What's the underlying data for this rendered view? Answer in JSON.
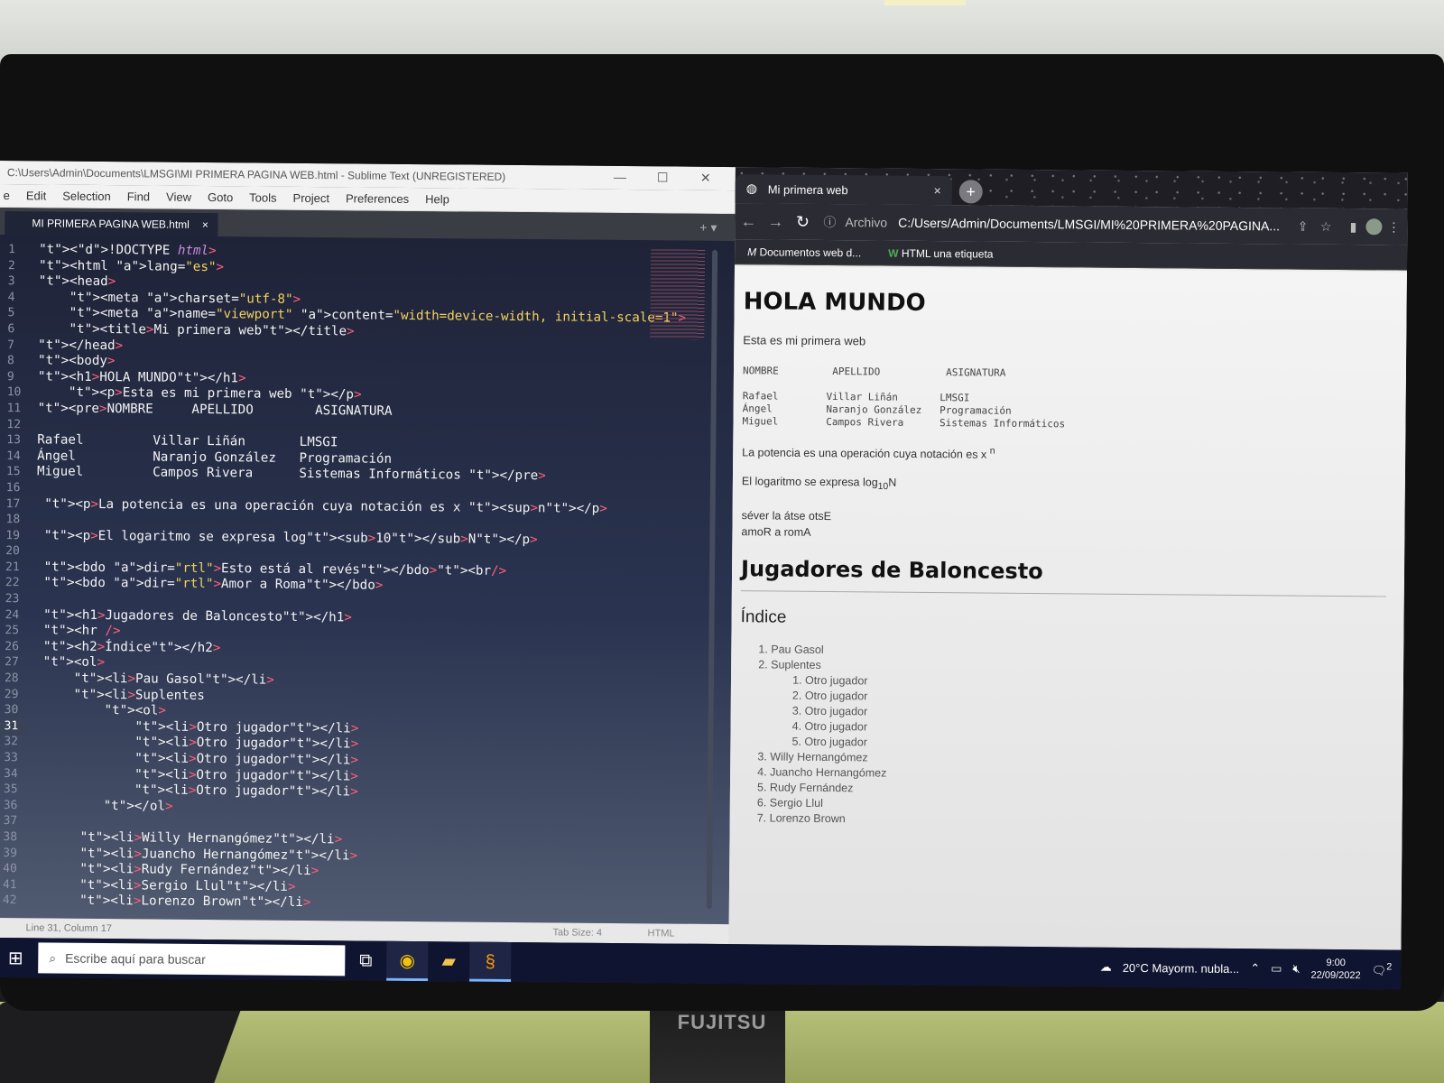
{
  "monitor_brand": "FUJITSU",
  "sublime": {
    "title": "C:\\Users\\Admin\\Documents\\LMSGI\\MI PRIMERA PAGINA WEB.html - Sublime Text (UNREGISTERED)",
    "menu": [
      "e",
      "Edit",
      "Selection",
      "Find",
      "View",
      "Goto",
      "Tools",
      "Project",
      "Preferences",
      "Help"
    ],
    "tab_label": "MI PRIMERA PAGINA WEB.html",
    "tab_close": "×",
    "active_line": 31,
    "status_position": "Line 31, Column 17",
    "status_tab_size": "Tab Size: 4",
    "status_syntax": "HTML"
  },
  "code_lines": [
    "<!DOCTYPE html>",
    "<html lang=\"es\">",
    "<head>",
    "    <meta charset=\"utf-8\">",
    "    <meta name=\"viewport\" content=\"width=device-width, initial-scale=1\">",
    "    <title>Mi primera web</title>",
    "</head>",
    "<body>",
    "<h1>HOLA MUNDO</h1>",
    "    <p>Esta es mi primera web </p>",
    "<pre>NOMBRE     APELLIDO        ASIGNATURA",
    "",
    "Rafael         Villar Liñán       LMSGI",
    "Ángel          Naranjo González   Programación",
    "Miguel         Campos Rivera      Sistemas Informáticos </pre>",
    "",
    " <p>La potencia es una operación cuya notación es x <sup>n</p>",
    "",
    " <p>El logaritmo se expresa log<sub>10</sub>N</p>",
    "",
    " <bdo dir=\"rtl\">Esto está al revés</bdo><br/>",
    " <bdo dir=\"rtl\">Amor a Roma</bdo>",
    "",
    " <h1>Jugadores de Baloncesto</h1>",
    " <hr />",
    " <h2>Índice</h2>",
    " <ol>",
    "     <li>Pau Gasol</li>",
    "     <li>Suplentes",
    "         <ol>",
    "             <li>Otro jugador</li>",
    "             <li>Otro jugador</li>",
    "             <li>Otro jugador</li>",
    "             <li>Otro jugador</li>",
    "             <li>Otro jugador</li>",
    "         </ol>",
    "",
    "      <li>Willy Hernangómez</li>",
    "      <li>Juancho Hernangómez</li>",
    "      <li>Rudy Fernández</li>",
    "      <li>Sergio Llul</li>",
    "      <li>Lorenzo Brown</li>"
  ],
  "browser": {
    "tab_title": "Mi primera web",
    "tab_close": "×",
    "new_tab": "+",
    "archivo": "Archivo",
    "url": "C:/Users/Admin/Documents/LMSGI/MI%20PRIMERA%20PAGINA...",
    "bookmarks": [
      "Documentos web d...",
      "HTML una etiqueta"
    ]
  },
  "page": {
    "h1": "HOLA MUNDO",
    "p1": "Esta es mi primera web",
    "pre_header": "NOMBRE         APELLIDO           ASIGNATURA",
    "pre_rows": "Rafael        Villar Liñán       LMSGI\nÁngel         Naranjo González   Programación\nMiguel        Campos Rivera      Sistemas Informáticos",
    "power_text": "La potencia es una operación cuya notación es x",
    "power_sup": "n",
    "log_text": "El logaritmo se expresa log",
    "log_sub": "10",
    "log_tail": "N",
    "bdo1": "séver la átse otsE",
    "bdo2": "amoR a romA",
    "h1b": "Jugadores de Baloncesto",
    "h2": "Índice",
    "list_first": "Pau Gasol",
    "list_second": "Suplentes",
    "sub_items": [
      "Otro jugador",
      "Otro jugador",
      "Otro jugador",
      "Otro jugador",
      "Otro jugador"
    ],
    "list_rest": [
      "Willy Hernangómez",
      "Juancho Hernangómez",
      "Rudy Fernández",
      "Sergio Llul",
      "Lorenzo Brown"
    ]
  },
  "taskbar": {
    "search_placeholder": "Escribe aquí para buscar",
    "weather": "20°C  Mayorm. nubla...",
    "time": "9:00",
    "date": "22/09/2022",
    "notification_count": "2"
  }
}
